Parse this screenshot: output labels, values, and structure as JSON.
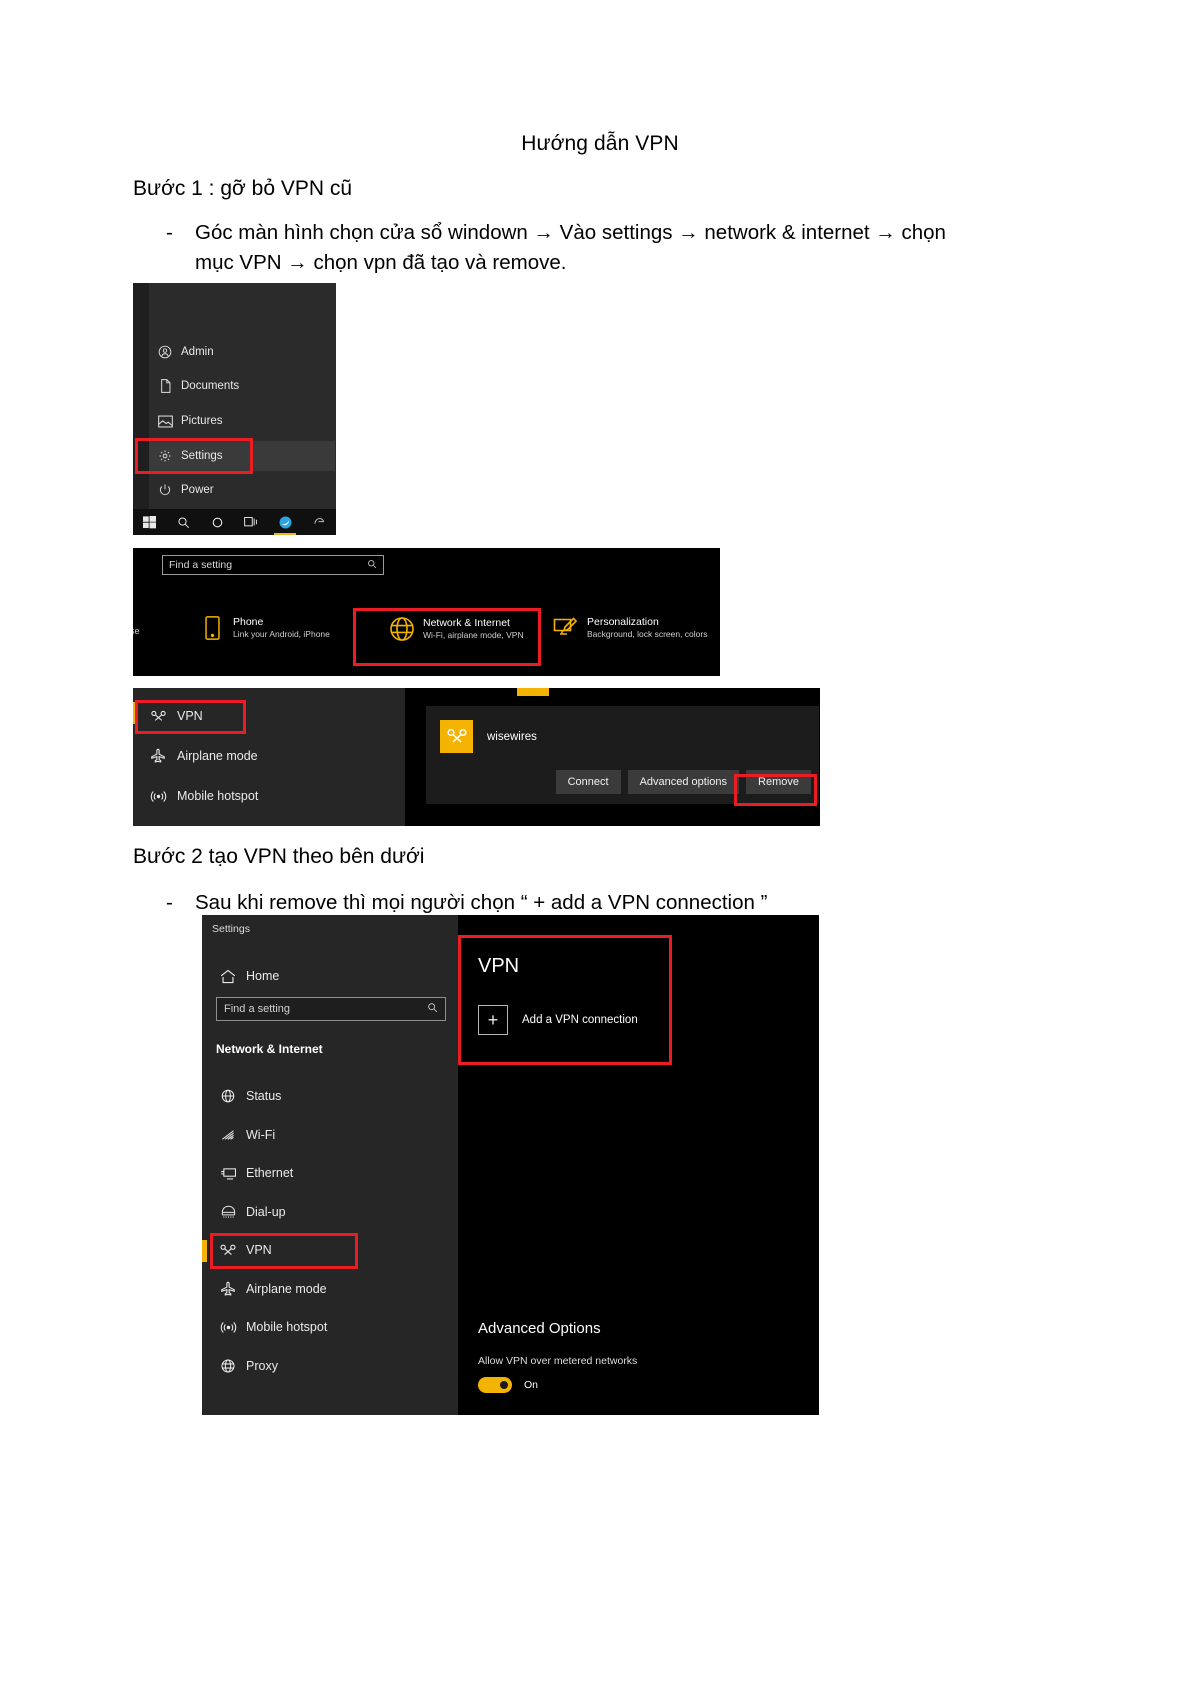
{
  "document": {
    "title": "Hướng dẫn VPN",
    "heading1": "Bước 1 : gỡ bỏ VPN cũ",
    "bullet1_dash": "-",
    "bullet1_text": "Góc màn hình chọn cửa sổ windown → Vào settings → network & internet → chọn mục VPN → chọn vpn đã tạo và remove.",
    "heading2": "Bước 2 tạo VPN theo bên dưới",
    "bullet2_dash": "-",
    "bullet2_text": "Sau khi remove thì mọi người chọn “ + add a VPN connection ”"
  },
  "colors": {
    "highlight_red": "#ec1c24",
    "accent_yellow": "#f5b301",
    "panel_dark": "#262626",
    "window_black": "#000000"
  },
  "start_menu": {
    "items": [
      {
        "label": "Admin",
        "icon": "user-icon"
      },
      {
        "label": "Documents",
        "icon": "document-icon"
      },
      {
        "label": "Pictures",
        "icon": "picture-icon"
      },
      {
        "label": "Settings",
        "icon": "gear-icon",
        "selected": true
      },
      {
        "label": "Power",
        "icon": "power-icon"
      }
    ],
    "taskbar": [
      {
        "icon": "windows-logo-icon"
      },
      {
        "icon": "search-icon"
      },
      {
        "icon": "cortana-circle-icon"
      },
      {
        "icon": "task-view-icon"
      },
      {
        "icon": "app-blue-icon",
        "active": true
      },
      {
        "icon": "app-edge-icon"
      }
    ]
  },
  "settings_home": {
    "search_placeholder": "Find a setting",
    "search_icon": "search-icon",
    "partial_left_label": "use",
    "tiles": [
      {
        "name": "Phone",
        "sub": "Link your Android, iPhone",
        "icon": "phone-icon"
      },
      {
        "name": "Network & Internet",
        "sub": "Wi-Fi, airplane mode, VPN",
        "icon": "globe-icon",
        "highlighted": true
      },
      {
        "name": "Personalization",
        "sub": "Background, lock screen, colors",
        "icon": "personalization-icon"
      }
    ]
  },
  "vpn_remove": {
    "sidebar_items": [
      {
        "label": "VPN",
        "icon": "vpn-icon",
        "highlighted": true
      },
      {
        "label": "Airplane mode",
        "icon": "airplane-icon"
      },
      {
        "label": "Mobile hotspot",
        "icon": "hotspot-icon"
      }
    ],
    "connection_name": "wisewires",
    "connection_icon": "vpn-tile-icon",
    "buttons": [
      {
        "label": "Connect"
      },
      {
        "label": "Advanced options"
      },
      {
        "label": "Remove",
        "highlighted": true
      }
    ]
  },
  "settings_window": {
    "window_title": "Settings",
    "home_label": "Home",
    "home_icon": "home-icon",
    "search_placeholder": "Find a setting",
    "search_icon": "search-icon",
    "section_title": "Network & Internet",
    "nav": [
      {
        "label": "Status",
        "icon": "status-icon"
      },
      {
        "label": "Wi-Fi",
        "icon": "wifi-icon"
      },
      {
        "label": "Ethernet",
        "icon": "ethernet-icon"
      },
      {
        "label": "Dial-up",
        "icon": "dialup-icon"
      },
      {
        "label": "VPN",
        "icon": "vpn-icon",
        "selected": true,
        "highlighted": true
      },
      {
        "label": "Airplane mode",
        "icon": "airplane-icon"
      },
      {
        "label": "Mobile hotspot",
        "icon": "hotspot-icon"
      },
      {
        "label": "Proxy",
        "icon": "proxy-icon"
      }
    ],
    "content": {
      "title": "VPN",
      "add_label": "Add a VPN connection",
      "add_icon": "plus-icon",
      "advanced_title": "Advanced Options",
      "metered_label": "Allow VPN over metered networks",
      "toggle_state": "On"
    }
  }
}
